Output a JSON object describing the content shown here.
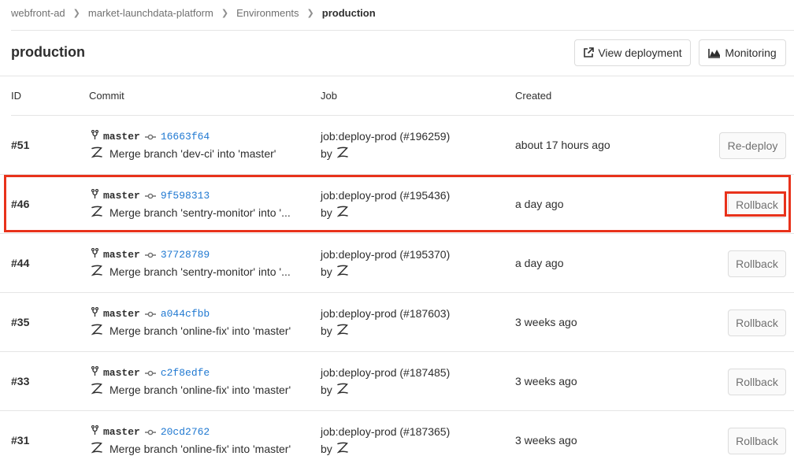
{
  "breadcrumb": [
    "webfront-ad",
    "market-launchdata-platform",
    "Environments",
    "production"
  ],
  "page_title": "production",
  "header_buttons": {
    "view_deployment": "View deployment",
    "monitoring": "Monitoring"
  },
  "columns": {
    "id": "ID",
    "commit": "Commit",
    "job": "Job",
    "created": "Created"
  },
  "deployments": [
    {
      "id": "#51",
      "branch": "master",
      "sha": "16663f64",
      "message": "Merge branch 'dev-ci' into 'master'",
      "job": "job:deploy-prod (#196259)",
      "by": "by",
      "created": "about 17 hours ago",
      "action": "Re-deploy"
    },
    {
      "id": "#46",
      "branch": "master",
      "sha": "9f598313",
      "message": "Merge branch 'sentry-monitor' into '...",
      "job": "job:deploy-prod (#195436)",
      "by": "by",
      "created": "a day ago",
      "action": "Rollback"
    },
    {
      "id": "#44",
      "branch": "master",
      "sha": "37728789",
      "message": "Merge branch 'sentry-monitor' into '...",
      "job": "job:deploy-prod (#195370)",
      "by": "by",
      "created": "a day ago",
      "action": "Rollback"
    },
    {
      "id": "#35",
      "branch": "master",
      "sha": "a044cfbb",
      "message": "Merge branch 'online-fix' into 'master'",
      "job": "job:deploy-prod (#187603)",
      "by": "by",
      "created": "3 weeks ago",
      "action": "Rollback"
    },
    {
      "id": "#33",
      "branch": "master",
      "sha": "c2f8edfe",
      "message": "Merge branch 'online-fix' into 'master'",
      "job": "job:deploy-prod (#187485)",
      "by": "by",
      "created": "3 weeks ago",
      "action": "Rollback"
    },
    {
      "id": "#31",
      "branch": "master",
      "sha": "20cd2762",
      "message": "Merge branch 'online-fix' into 'master'",
      "job": "job:deploy-prod (#187365)",
      "by": "by",
      "created": "3 weeks ago",
      "action": "Rollback"
    }
  ],
  "colors": {
    "link": "#1f78d1",
    "highlight": "#e8321b",
    "border": "#e5e5e5"
  }
}
